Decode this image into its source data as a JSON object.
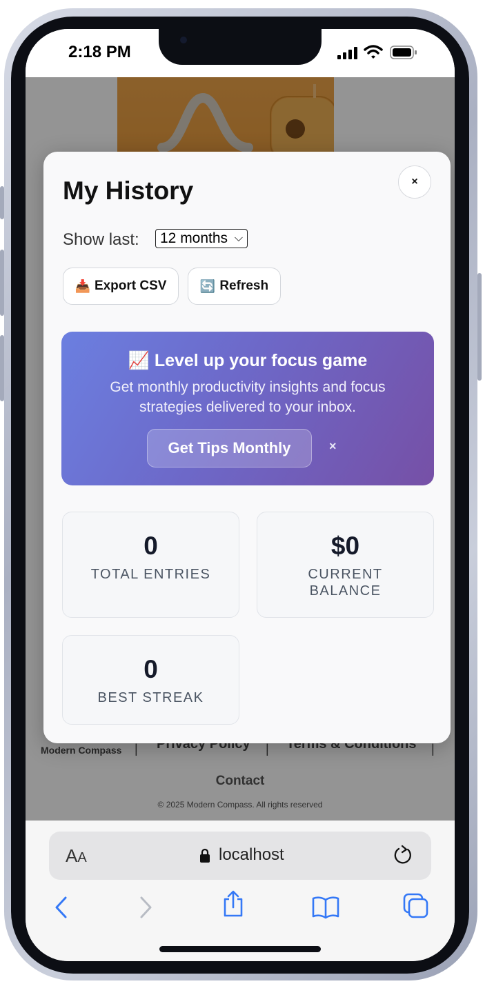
{
  "status": {
    "time": "2:18 PM"
  },
  "modal": {
    "title": "My History",
    "close_label": "×",
    "show_last_label": "Show last:",
    "period_selected": "12 months",
    "export_button": "Export CSV",
    "export_icon": "📥",
    "refresh_button": "Refresh",
    "refresh_icon": "🔄"
  },
  "promo": {
    "icon": "📈",
    "title": "Level up your focus game",
    "text": "Get monthly productivity insights and focus strategies delivered to your inbox.",
    "button": "Get Tips Monthly",
    "dismiss": "×"
  },
  "stats": [
    {
      "value": "0",
      "label": "TOTAL ENTRIES"
    },
    {
      "value": "$0",
      "label": "CURRENT BALANCE"
    },
    {
      "value": "0",
      "label": "BEST STREAK"
    }
  ],
  "footer": {
    "brand": "Modern Compass",
    "privacy": "Privacy Policy",
    "terms": "Terms & Conditions",
    "separator": "|",
    "contact": "Contact",
    "copyright": "© 2025 Modern Compass. All rights reserved"
  },
  "browser": {
    "aa_big": "A",
    "aa_small": "A",
    "host": "localhost"
  },
  "icons": [
    "camera-icon",
    "signal-icon",
    "wifi-icon",
    "battery-icon",
    "lock-icon",
    "reload-icon",
    "back-icon",
    "forward-icon",
    "share-icon",
    "bookmarks-icon",
    "tabs-icon"
  ],
  "colors": {
    "accent": "#3478f6",
    "promo_start": "#6b7fe0",
    "promo_end": "#7650a6",
    "wallet": "#f0a64a"
  }
}
